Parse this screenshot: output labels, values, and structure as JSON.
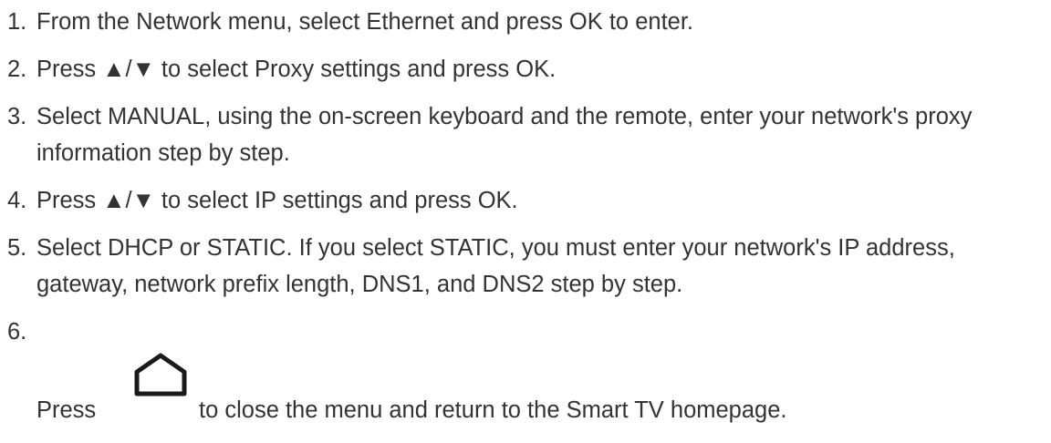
{
  "steps": [
    {
      "num": "1.",
      "text": "From the Network menu, select Ethernet and press OK to enter."
    },
    {
      "num": "2.",
      "text": "Press ▲/▼ to select Proxy settings and press OK."
    },
    {
      "num": "3.",
      "text": "Select MANUAL, using the on-screen keyboard and the remote, enter your network's proxy information step by step."
    },
    {
      "num": "4.",
      "text": "Press ▲/▼ to select IP settings and press OK."
    },
    {
      "num": "5.",
      "text": "Select DHCP or STATIC. If you select STATIC, you must enter your network's IP address, gateway, network prefix length, DNS1, and DNS2 step by step."
    }
  ],
  "final_step": {
    "num": "6.",
    "press": "Press",
    "icon": "home-icon",
    "rest": "to close the menu and return to the Smart TV homepage."
  }
}
